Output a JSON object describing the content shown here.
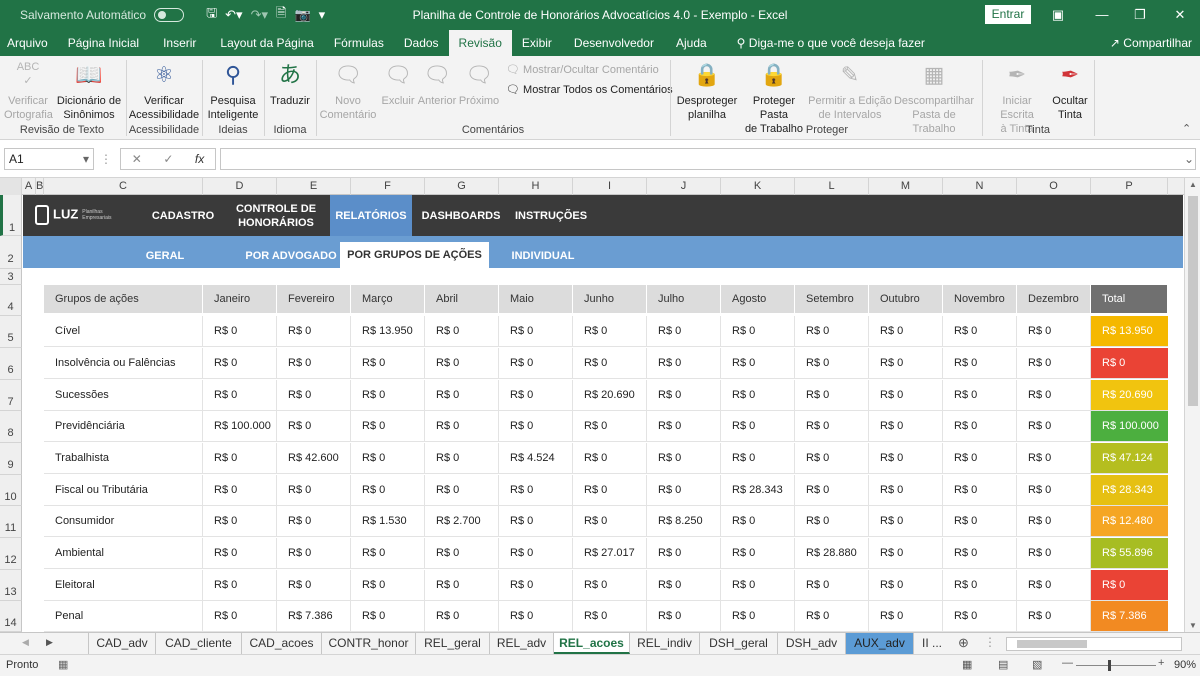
{
  "titlebar": {
    "autosave_label": "Salvamento Automático",
    "title": "Planilha de Controle de Honorários Advocatícios 4.0 - Exemplo  -  Excel",
    "signin": "Entrar"
  },
  "menu": {
    "items": [
      "Arquivo",
      "Página Inicial",
      "Inserir",
      "Layout da Página",
      "Fórmulas",
      "Dados",
      "Revisão",
      "Exibir",
      "Desenvolvedor",
      "Ajuda"
    ],
    "active": "Revisão",
    "tell_me": "Diga-me o que você deseja fazer",
    "share": "Compartilhar"
  },
  "ribbon": {
    "spelling": "Verificar\nOrtografia",
    "thesaurus": "Dicionário de\nSinônimos",
    "grp_proofing": "Revisão de Texto",
    "accessibility": "Verificar\nAcessibilidade",
    "grp_accessibility": "Acessibilidade",
    "smart_lookup": "Pesquisa\nInteligente",
    "grp_insights": "Ideias",
    "translate": "Traduzir",
    "grp_language": "Idioma",
    "new_comment": "Novo\nComentário",
    "delete": "Excluir",
    "previous": "Anterior",
    "next": "Próximo",
    "show_hide_comment": "Mostrar/Ocultar Comentário",
    "show_all_comments": "Mostrar Todos os Comentários",
    "grp_comments": "Comentários",
    "unprotect_sheet": "Desproteger\nplanilha",
    "protect_workbook": "Proteger Pasta\nde Trabalho",
    "allow_edit_ranges": "Permitir a Edição\nde Intervalos",
    "unshare_workbook": "Descompartilhar\nPasta de Trabalho",
    "grp_protect": "Proteger",
    "start_inking": "Iniciar Escrita\nà Tinta",
    "hide_ink": "Ocultar\nTinta",
    "grp_ink": "Tinta"
  },
  "formula": {
    "namebox": "A1",
    "fx": "fx",
    "value": ""
  },
  "columns": [
    "A",
    "B",
    "C",
    "D",
    "E",
    "F",
    "G",
    "H",
    "I",
    "J",
    "K",
    "L",
    "M",
    "N",
    "O",
    "P"
  ],
  "rows": [
    "1",
    "2",
    "3",
    "4",
    "5",
    "6",
    "7",
    "8",
    "9",
    "10",
    "11",
    "12",
    "13",
    "14"
  ],
  "nav": {
    "logo": "LUZ",
    "logo_sub": "Planilhas Empresariais",
    "items": [
      "CADASTRO",
      "CONTROLE DE\nHONORÁRIOS",
      "RELATÓRIOS",
      "DASHBOARDS",
      "INSTRUÇÕES"
    ],
    "active": "RELATÓRIOS"
  },
  "subnav": {
    "items": [
      "GERAL",
      "POR ADVOGADO",
      "POR GRUPOS DE AÇÕES",
      "INDIVIDUAL"
    ],
    "active": "POR GRUPOS DE AÇÕES"
  },
  "table": {
    "headers": [
      "Grupos de ações",
      "Janeiro",
      "Fevereiro",
      "Março",
      "Abril",
      "Maio",
      "Junho",
      "Julho",
      "Agosto",
      "Setembro",
      "Outubro",
      "Novembro",
      "Dezembro",
      "Total"
    ],
    "rows": [
      {
        "group": "Cível",
        "values": [
          "R$ 0",
          "R$ 0",
          "R$ 13.950",
          "R$ 0",
          "R$ 0",
          "R$ 0",
          "R$ 0",
          "R$ 0",
          "R$ 0",
          "R$ 0",
          "R$ 0",
          "R$ 0"
        ],
        "total": "R$ 13.950",
        "color": "#f5b800"
      },
      {
        "group": "Insolvência ou Falências",
        "values": [
          "R$ 0",
          "R$ 0",
          "R$ 0",
          "R$ 0",
          "R$ 0",
          "R$ 0",
          "R$ 0",
          "R$ 0",
          "R$ 0",
          "R$ 0",
          "R$ 0",
          "R$ 0"
        ],
        "total": "R$ 0",
        "color": "#ea4335"
      },
      {
        "group": "Sucessões",
        "values": [
          "R$ 0",
          "R$ 0",
          "R$ 0",
          "R$ 0",
          "R$ 0",
          "R$ 20.690",
          "R$ 0",
          "R$ 0",
          "R$ 0",
          "R$ 0",
          "R$ 0",
          "R$ 0"
        ],
        "total": "R$ 20.690",
        "color": "#f1c40f"
      },
      {
        "group": "Previdênciária",
        "values": [
          "R$ 100.000",
          "R$ 0",
          "R$ 0",
          "R$ 0",
          "R$ 0",
          "R$ 0",
          "R$ 0",
          "R$ 0",
          "R$ 0",
          "R$ 0",
          "R$ 0",
          "R$ 0"
        ],
        "total": "R$ 100.000",
        "color": "#4caf3f"
      },
      {
        "group": "Trabalhista",
        "values": [
          "R$ 0",
          "R$ 42.600",
          "R$ 0",
          "R$ 0",
          "R$ 4.524",
          "R$ 0",
          "R$ 0",
          "R$ 0",
          "R$ 0",
          "R$ 0",
          "R$ 0",
          "R$ 0"
        ],
        "total": "R$ 47.124",
        "color": "#b5be1f"
      },
      {
        "group": "Fiscal ou Tributária",
        "values": [
          "R$ 0",
          "R$ 0",
          "R$ 0",
          "R$ 0",
          "R$ 0",
          "R$ 0",
          "R$ 0",
          "R$ 28.343",
          "R$ 0",
          "R$ 0",
          "R$ 0",
          "R$ 0"
        ],
        "total": "R$ 28.343",
        "color": "#e6c012"
      },
      {
        "group": "Consumidor",
        "values": [
          "R$ 0",
          "R$ 0",
          "R$ 1.530",
          "R$ 2.700",
          "R$ 0",
          "R$ 0",
          "R$ 8.250",
          "R$ 0",
          "R$ 0",
          "R$ 0",
          "R$ 0",
          "R$ 0"
        ],
        "total": "R$ 12.480",
        "color": "#f5a623"
      },
      {
        "group": "Ambiental",
        "values": [
          "R$ 0",
          "R$ 0",
          "R$ 0",
          "R$ 0",
          "R$ 0",
          "R$ 27.017",
          "R$ 0",
          "R$ 0",
          "R$ 28.880",
          "R$ 0",
          "R$ 0",
          "R$ 0"
        ],
        "total": "R$ 55.896",
        "color": "#a7bd22"
      },
      {
        "group": "Eleitoral",
        "values": [
          "R$ 0",
          "R$ 0",
          "R$ 0",
          "R$ 0",
          "R$ 0",
          "R$ 0",
          "R$ 0",
          "R$ 0",
          "R$ 0",
          "R$ 0",
          "R$ 0",
          "R$ 0"
        ],
        "total": "R$ 0",
        "color": "#ea4335"
      },
      {
        "group": "Penal",
        "values": [
          "R$ 0",
          "R$ 7.386",
          "R$ 0",
          "R$ 0",
          "R$ 0",
          "R$ 0",
          "R$ 0",
          "R$ 0",
          "R$ 0",
          "R$ 0",
          "R$ 0",
          "R$ 0"
        ],
        "total": "R$ 7.386",
        "color": "#f28a22"
      }
    ]
  },
  "tabs": {
    "items": [
      "CAD_adv",
      "CAD_cliente",
      "CAD_acoes",
      "CONTR_honor",
      "REL_geral",
      "REL_adv",
      "REL_acoes",
      "REL_indiv",
      "DSH_geral",
      "DSH_adv",
      "AUX_adv",
      "II ..."
    ],
    "active": "REL_acoes",
    "highlighted": "AUX_adv"
  },
  "status": {
    "ready": "Pronto",
    "zoom": "90%"
  },
  "colors": {
    "excel_green": "#217346",
    "nav_dark": "#3a3a3a",
    "nav_blue": "#6a9dd2"
  }
}
